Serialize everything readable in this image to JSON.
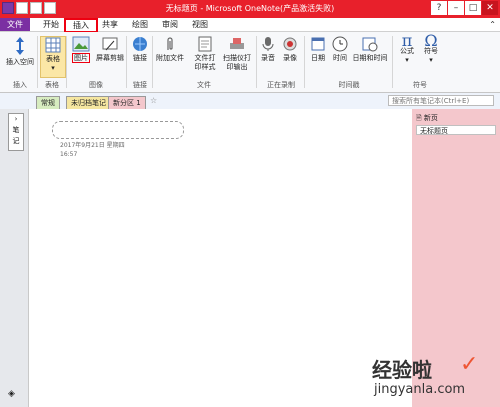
{
  "app": {
    "title": "无标题页 - Microsoft OneNote(产品激活失败)"
  },
  "menu": {
    "tabs": [
      "文件",
      "开始",
      "插入",
      "共享",
      "绘图",
      "审阅",
      "视图"
    ],
    "active": "插入"
  },
  "ribbon": {
    "buttons": [
      "插入空间",
      "表格",
      "图片",
      "屏幕剪辑",
      "链接",
      "附加文件",
      "文件打印样式",
      "扫描仪打印输出",
      "录音",
      "录像",
      "日期",
      "时间",
      "日期和时间",
      "公式",
      "符号"
    ],
    "groups": [
      "插入",
      "表格",
      "图像",
      "链接",
      "文件",
      "正在录制",
      "时间戳",
      "符号"
    ]
  },
  "notebook": {
    "tabs": [
      "常规",
      "未归档笔记",
      "新分区 1"
    ],
    "search_placeholder": "搜索所有笔记本(Ctrl+E)"
  },
  "page": {
    "date": "2017年9月21日 星期四",
    "time": "16:57"
  },
  "right_panel": {
    "new_page_label": "新页",
    "page_item": "无标题页"
  },
  "watermark": {
    "text_cn": "经验啦",
    "text_en": "jingyanla.com"
  },
  "colors": {
    "titlebar": "#e8202b",
    "file_tab": "#7b2fa2",
    "pages_panel": "#f4c7cc",
    "highlight": "#e01010"
  }
}
